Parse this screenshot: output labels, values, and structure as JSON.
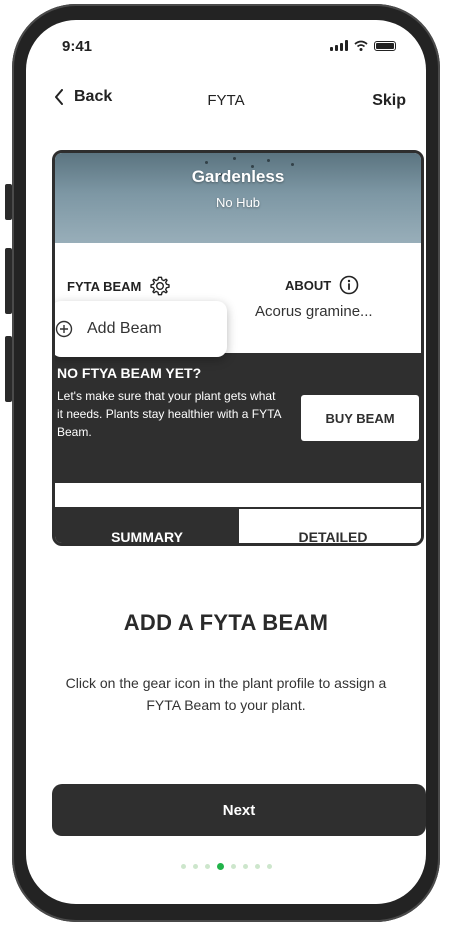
{
  "status_bar": {
    "time": "9:41"
  },
  "nav": {
    "back_label": "Back",
    "title": "FYTA",
    "skip_label": "Skip"
  },
  "preview": {
    "hero_title": "Gardenless",
    "hero_subtitle": "No Hub",
    "beam_label": "FYTA BEAM",
    "about_label": "ABOUT",
    "about_value": "Acorus gramine...",
    "add_beam_label": "Add Beam",
    "promo_title": "NO FTYA BEAM YET?",
    "promo_text": "Let's make sure that your plant gets what it needs. Plants stay healthier with a FYTA Beam.",
    "buy_beam_label": "BUY BEAM",
    "tab_summary": "SUMMARY",
    "tab_detailed": "DETAILED"
  },
  "content": {
    "heading": "ADD A FYTA BEAM",
    "description": "Click on the gear icon in the plant profile to assign a FYTA Beam to your plant."
  },
  "next_label": "Next",
  "pager": {
    "total": 8,
    "active_index": 3
  },
  "icons": [
    "chevron-left-icon",
    "gear-icon",
    "info-icon",
    "plus-circle-icon",
    "signal-icon",
    "wifi-icon",
    "battery-icon"
  ],
  "colors": {
    "dark": "#2f2f2f",
    "accent_green": "#22b34a",
    "dot_inactive": "#cde6cc"
  }
}
